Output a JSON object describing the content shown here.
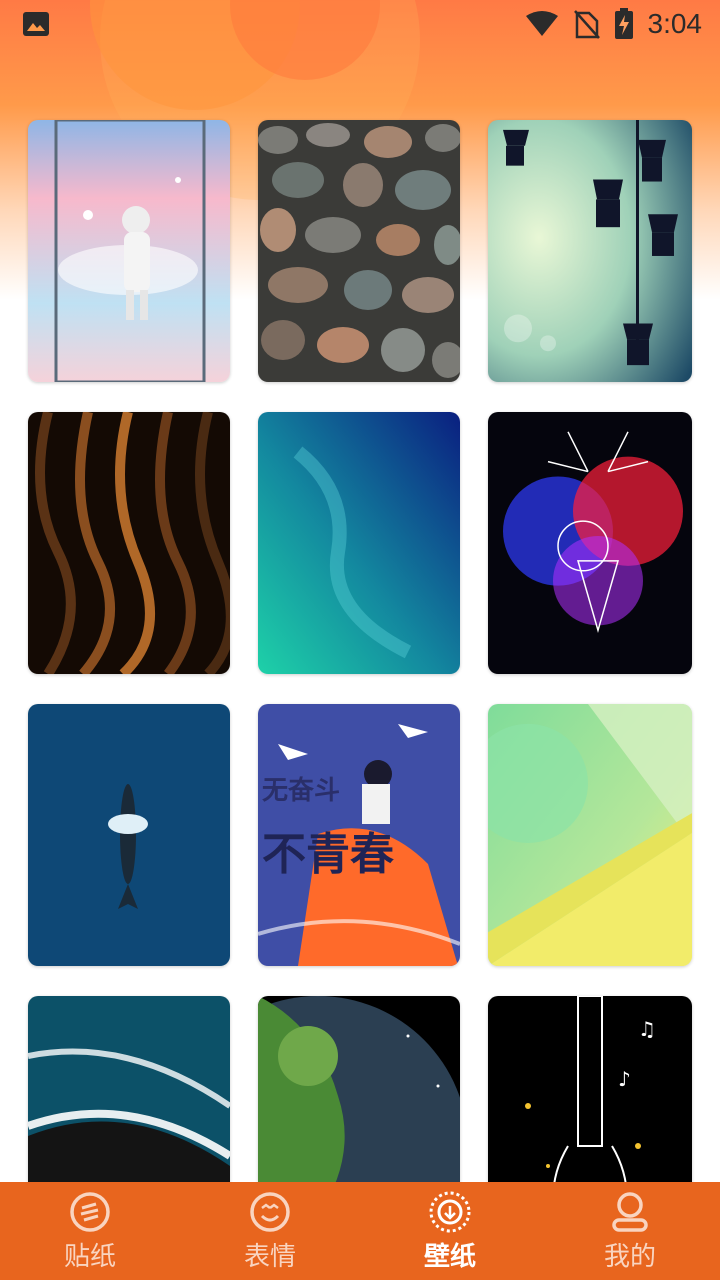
{
  "status_bar": {
    "time": "3:04",
    "icons": [
      "image-icon",
      "wifi-icon",
      "no-sim-icon",
      "battery-charging-icon"
    ]
  },
  "wallpapers": [
    {
      "name": "astronaut-pink-sky",
      "colors": [
        "#f7b6c8",
        "#9fd4f2"
      ]
    },
    {
      "name": "pebbles",
      "colors": [
        "#6a6a66",
        "#3d3d3a"
      ]
    },
    {
      "name": "street-lamps",
      "colors": [
        "#c9e8b8",
        "#1e3a55"
      ]
    },
    {
      "name": "brown-waves",
      "colors": [
        "#2a1608",
        "#a05a22"
      ]
    },
    {
      "name": "ocean-aerial-teal",
      "colors": [
        "#1fc1a8",
        "#0a2e8a"
      ]
    },
    {
      "name": "neon-deer",
      "colors": [
        "#0b0b1a",
        "#ff2855"
      ]
    },
    {
      "name": "whale-deep-blue",
      "colors": [
        "#0f4a78",
        "#0b2f55"
      ]
    },
    {
      "name": "girl-youth-poster",
      "colors": [
        "#3b4aa0",
        "#ff6a2a"
      ]
    },
    {
      "name": "green-yellow-abstract",
      "colors": [
        "#7fd8a0",
        "#f2ee6a"
      ]
    },
    {
      "name": "beach-waves-aerial",
      "colors": [
        "#0a4f66",
        "#111111"
      ]
    },
    {
      "name": "planet-earth",
      "colors": [
        "#000000",
        "#4a8a3a"
      ]
    },
    {
      "name": "neon-guitar",
      "colors": [
        "#000000",
        "#ffd23a"
      ]
    }
  ],
  "poster_text": [
    "无奋斗",
    "不青春"
  ],
  "bottom_nav": [
    {
      "label": "贴纸",
      "icon": "sticker-icon",
      "active": false
    },
    {
      "label": "表情",
      "icon": "emoji-icon",
      "active": false
    },
    {
      "label": "壁纸",
      "icon": "wallpaper-icon",
      "active": true
    },
    {
      "label": "我的",
      "icon": "profile-icon",
      "active": false
    }
  ],
  "theme": {
    "accent": "#e8651e",
    "header_gradient_top": "#ff7a45"
  }
}
